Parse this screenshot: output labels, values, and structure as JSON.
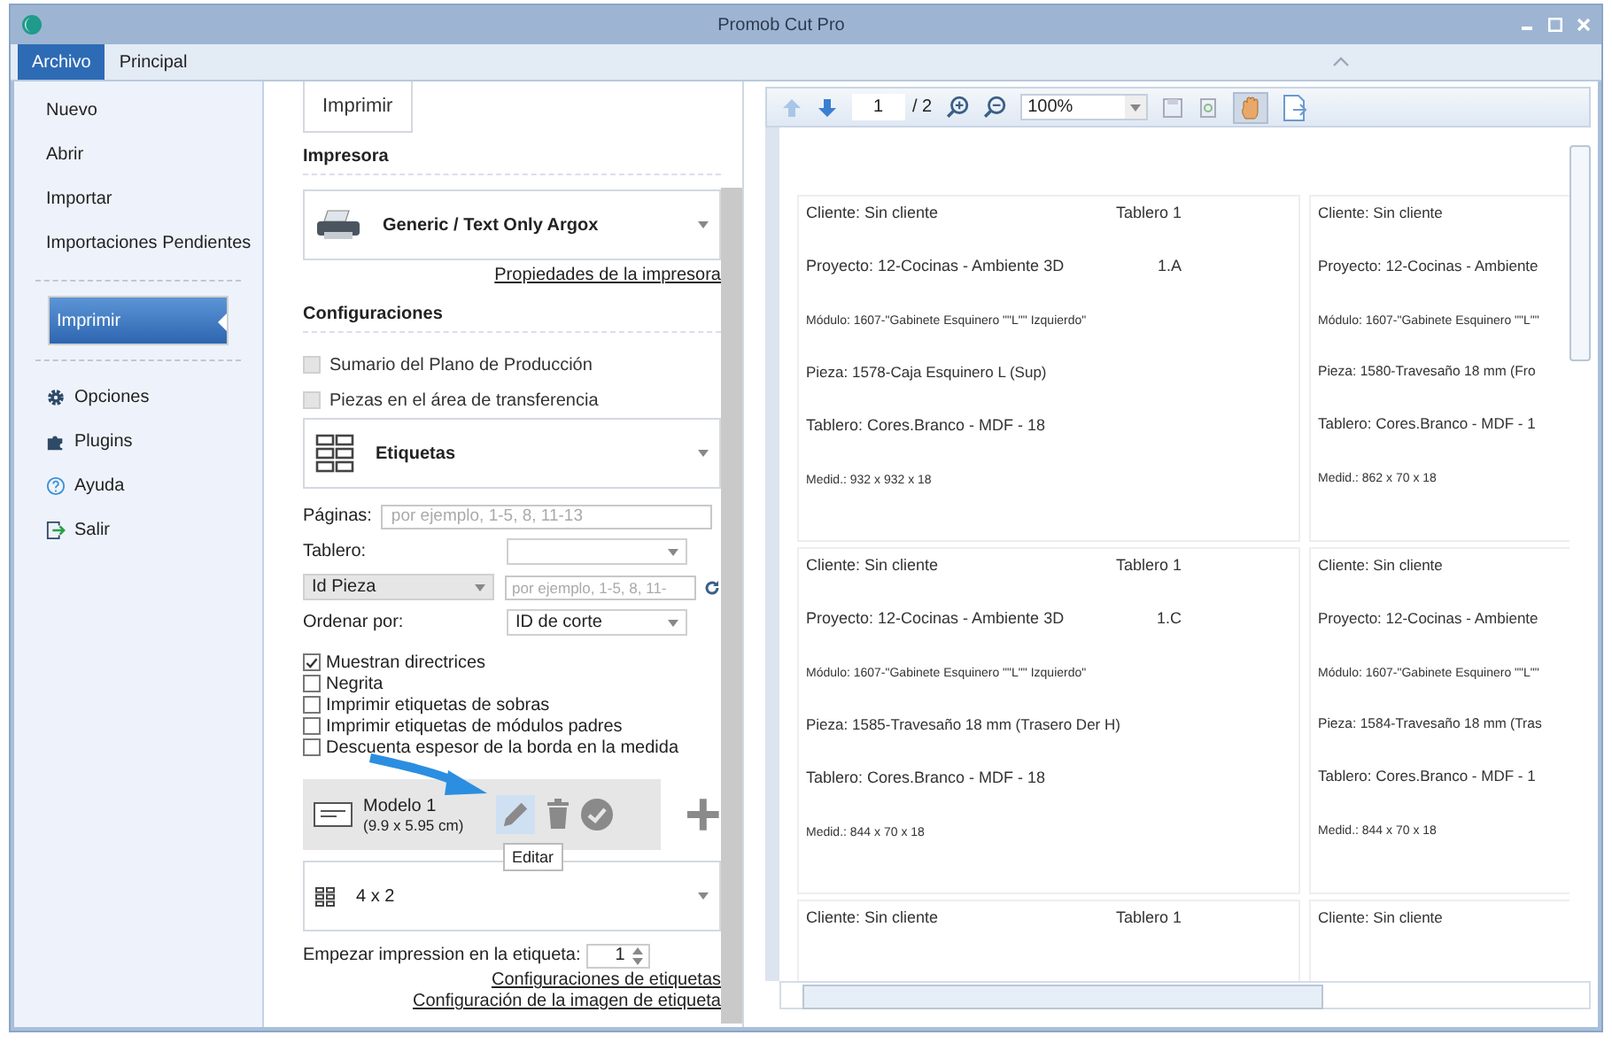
{
  "window": {
    "title": "Promob Cut Pro"
  },
  "tabs": [
    {
      "label": "Archivo",
      "selected": true
    },
    {
      "label": "Principal",
      "selected": false
    }
  ],
  "sidebar": {
    "groups": [
      {
        "items": [
          {
            "label": "Nuevo",
            "selected": false
          },
          {
            "label": "Abrir",
            "selected": false
          },
          {
            "label": "Importar",
            "selected": false
          },
          {
            "label": "Importaciones Pendientes",
            "selected": false
          }
        ]
      },
      {
        "items": [
          {
            "label": "Imprimir",
            "selected": true
          }
        ]
      },
      {
        "items": [
          {
            "label": "Opciones",
            "selected": false,
            "kind": "gear"
          },
          {
            "label": "Plugins",
            "selected": false,
            "kind": "puzzle"
          },
          {
            "label": "Ayuda",
            "selected": false,
            "kind": "help"
          },
          {
            "label": "Salir",
            "selected": false,
            "kind": "exit"
          }
        ]
      }
    ]
  },
  "print_panel": {
    "print_button": "Imprimir",
    "printer": {
      "heading": "Impresora",
      "name": "Generic / Text Only Argox",
      "link": "Propiedades de la impresora"
    },
    "config": {
      "heading": "Configuraciones",
      "options": [
        {
          "label": "Sumario del Plano de Producción",
          "checked": false,
          "disabled": true
        },
        {
          "label": "Piezas en el área de transferencia",
          "checked": false,
          "disabled": true
        }
      ],
      "report": "Etiquetas",
      "pages": {
        "label": "Páginas:",
        "placeholder": "por ejemplo, 1-5, 8, 11-13"
      },
      "board": {
        "label": "Tablero:"
      },
      "filter": {
        "field": "Id Pieza",
        "placeholder": "por ejemplo, 1-5, 8, 11-"
      },
      "order": {
        "label": "Ordenar por:",
        "value": "ID de corte"
      },
      "flags": [
        {
          "label": "Muestran directrices",
          "checked": true
        },
        {
          "label": "Negrita",
          "checked": false
        },
        {
          "label": "Imprimir etiquetas de sobras",
          "checked": false
        },
        {
          "label": "Imprimir etiquetas de módulos padres",
          "checked": false
        },
        {
          "label": "Descuenta espesor de la borda en la medida",
          "checked": false
        }
      ],
      "model": {
        "name": "Modelo 1",
        "size": "(9.9 x 5.95 cm)",
        "tooltip": "Editar"
      },
      "layout": "4 x 2",
      "start": {
        "label": "Empezar impression en la etiqueta:",
        "value": "1"
      },
      "links": [
        "Configuraciones de etiquetas",
        "Configuración de la imagen de etiqueta"
      ]
    }
  },
  "preview": {
    "toolbar": {
      "page": "1",
      "total": "/ 2",
      "zoom": "100%"
    },
    "label_rows": [
      [
        {
          "cliente": "Cliente: Sin cliente",
          "board_id": "Tablero 1",
          "proyecto": "Proyecto: 12-Cocinas - Ambiente 3D",
          "code": "1.A",
          "modulo": "Módulo: 1607-\"Gabinete Esquinero \"\"L\"\" Izquierdo\"",
          "pieza": "Pieza: 1578-Caja Esquinero L (Sup)",
          "tablero": "Tablero: Cores.Branco - MDF - 18",
          "medida": "Medid.: 932 x 932 x 18"
        },
        {
          "cliente": "Cliente: Sin cliente",
          "proyecto": "Proyecto: 12-Cocinas - Ambiente",
          "modulo": "Módulo: 1607-\"Gabinete Esquinero \"\"L\"\"",
          "pieza": "Pieza: 1580-Travesaño 18 mm (Fro",
          "tablero": "Tablero: Cores.Branco - MDF - 1",
          "medida": "Medid.: 862 x 70 x 18"
        }
      ],
      [
        {
          "cliente": "Cliente: Sin cliente",
          "board_id": "Tablero 1",
          "proyecto": "Proyecto: 12-Cocinas - Ambiente 3D",
          "code": "1.C",
          "modulo": "Módulo: 1607-\"Gabinete Esquinero \"\"L\"\" Izquierdo\"",
          "pieza": "Pieza: 1585-Travesaño 18 mm (Trasero Der H)",
          "tablero": "Tablero: Cores.Branco - MDF - 18",
          "medida": "Medid.: 844 x 70 x 18"
        },
        {
          "cliente": "Cliente: Sin cliente",
          "proyecto": "Proyecto: 12-Cocinas - Ambiente",
          "modulo": "Módulo: 1607-\"Gabinete Esquinero \"\"L\"\"",
          "pieza": "Pieza: 1584-Travesaño 18 mm (Tras",
          "tablero": "Tablero: Cores.Branco - MDF - 1",
          "medida": "Medid.: 844 x 70 x 18"
        }
      ],
      [
        {
          "cliente": "Cliente: Sin cliente",
          "board_id": "Tablero 1"
        },
        {
          "cliente": "Cliente: Sin cliente"
        }
      ]
    ]
  }
}
